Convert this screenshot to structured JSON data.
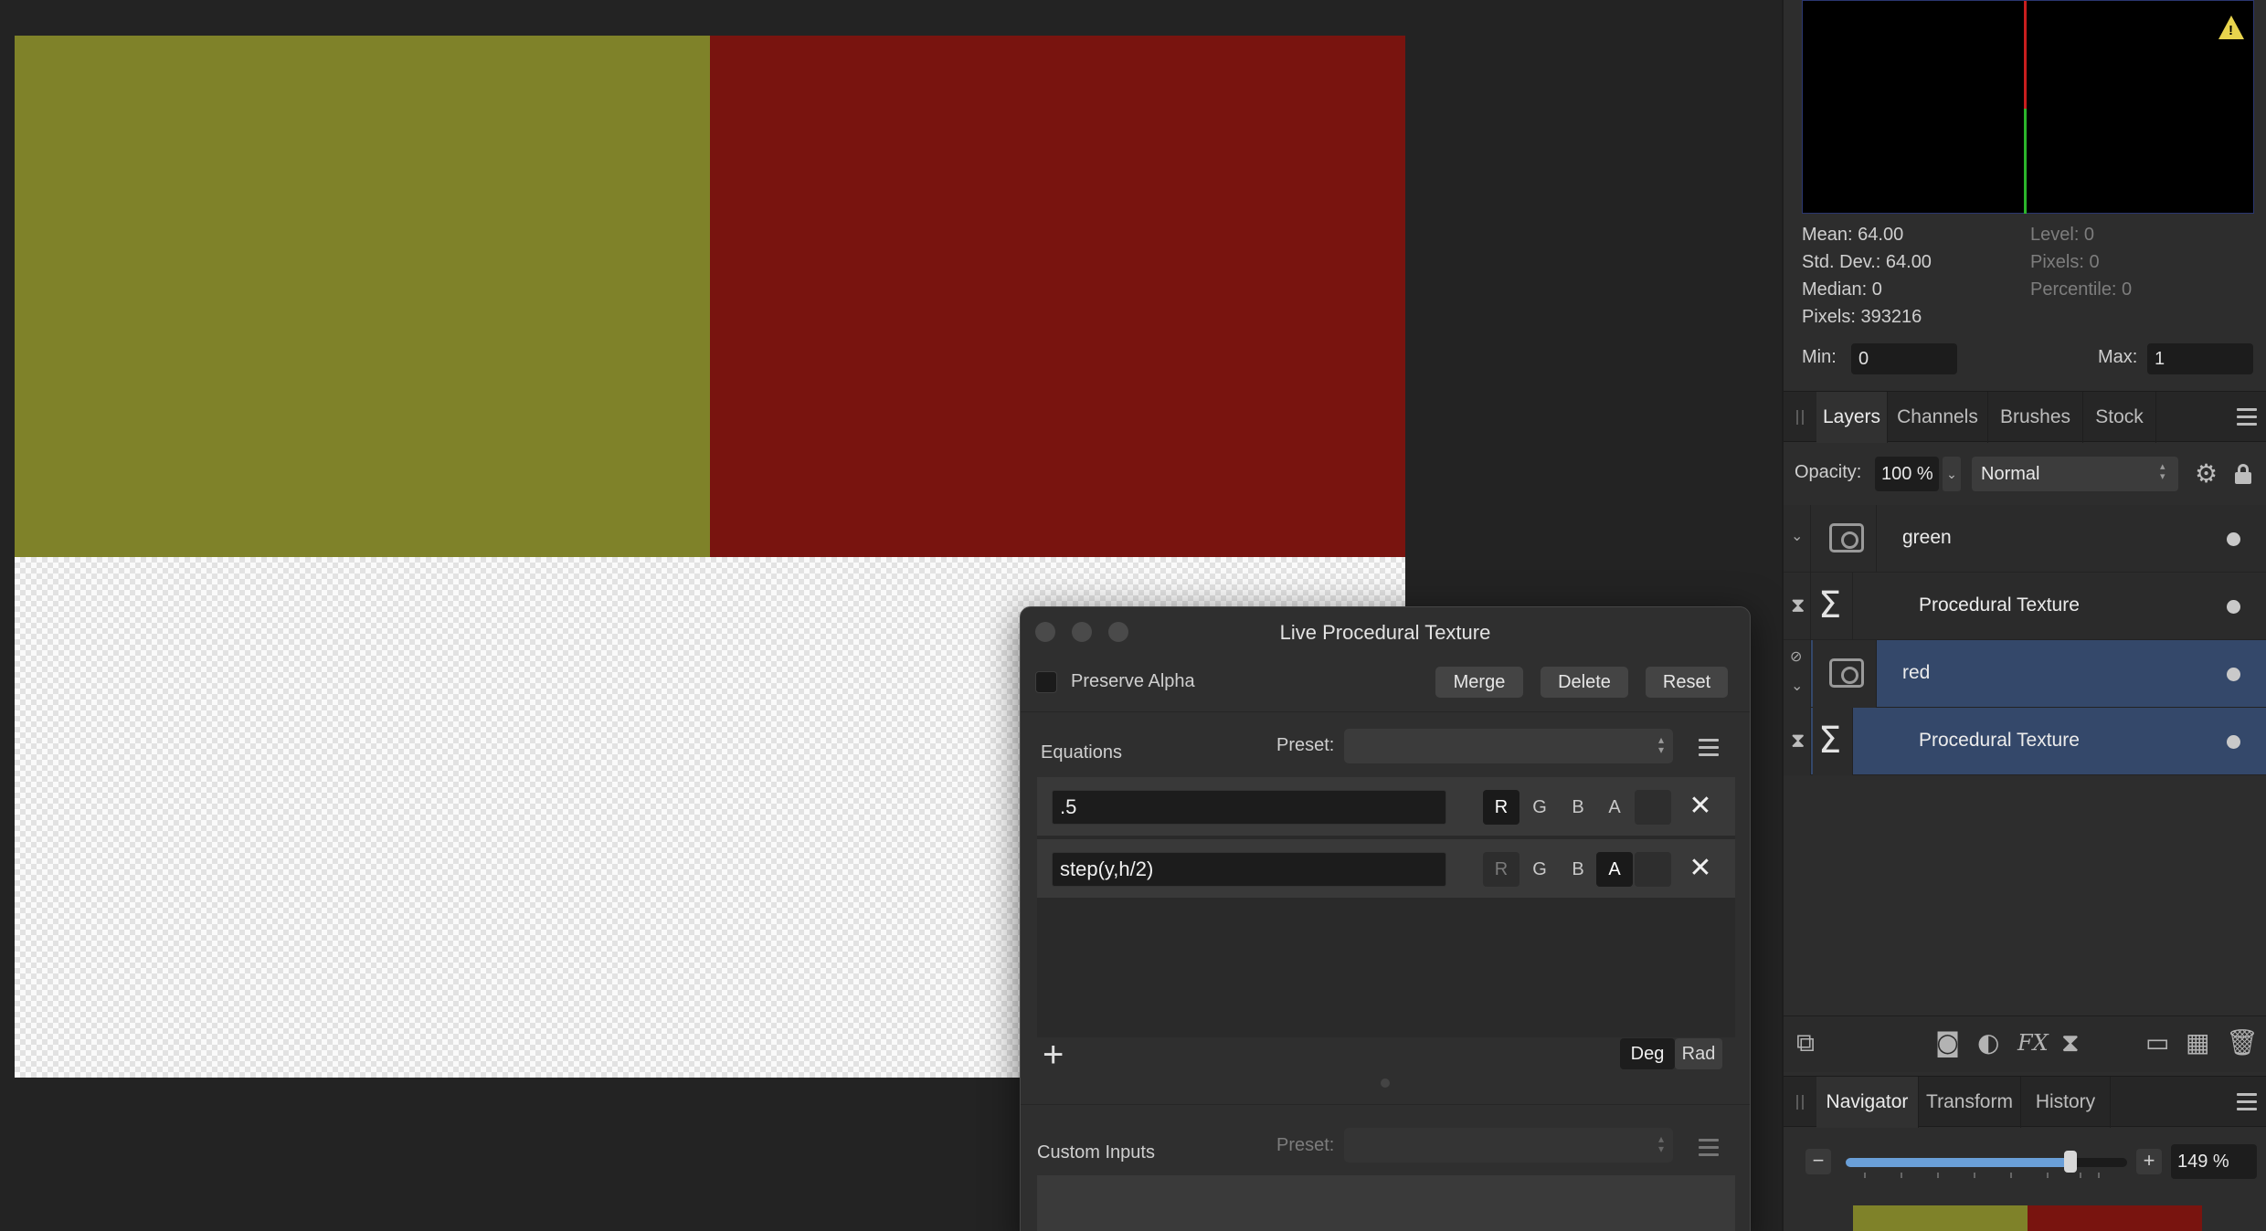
{
  "canvas": {
    "colors": {
      "green_area": "#7f8229",
      "red_area": "#79140f"
    }
  },
  "dialog": {
    "title": "Live Procedural Texture",
    "preserve_alpha_label": "Preserve Alpha",
    "merge_label": "Merge",
    "delete_label": "Delete",
    "reset_label": "Reset",
    "equations_label": "Equations",
    "preset_label": "Preset:",
    "equations": [
      {
        "expr": ".5",
        "channels": [
          "R",
          "G",
          "B",
          "A"
        ],
        "active": "R"
      },
      {
        "expr": "step(y,h/2)",
        "channels": [
          "R",
          "G",
          "B",
          "A"
        ],
        "active": "A"
      }
    ],
    "add_icon": "+",
    "deg_label": "Deg",
    "rad_label": "Rad",
    "custom_inputs_label": "Custom Inputs",
    "custom_preset_label": "Preset:"
  },
  "histogram": {
    "mean": "Mean: 64.00",
    "std_dev": "Std. Dev.: 64.00",
    "median": "Median: 0",
    "pixels": "Pixels: 393216",
    "level": "Level: 0",
    "level_pixels": "Pixels: 0",
    "percentile": "Percentile: 0",
    "min_label": "Min:",
    "min_value": "0",
    "max_label": "Max:",
    "max_value": "1",
    "warning_icon": "warning-triangle-icon"
  },
  "layers_panel": {
    "tabs": [
      "Layers",
      "Channels",
      "Brushes",
      "Stock"
    ],
    "opacity_label": "Opacity:",
    "opacity_value": "100 %",
    "blend_mode": "Normal",
    "layers": [
      {
        "name": "green",
        "type": "pixel-group",
        "selected": false
      },
      {
        "name": "Procedural Texture",
        "type": "procedural",
        "selected": false
      },
      {
        "name": "red",
        "type": "pixel-group",
        "selected": true
      },
      {
        "name": "Procedural Texture",
        "type": "procedural",
        "selected": true
      }
    ]
  },
  "navigator_panel": {
    "tabs": [
      "Navigator",
      "Transform",
      "History"
    ],
    "zoom_value": "149 %",
    "zoom_fraction": 0.8
  }
}
